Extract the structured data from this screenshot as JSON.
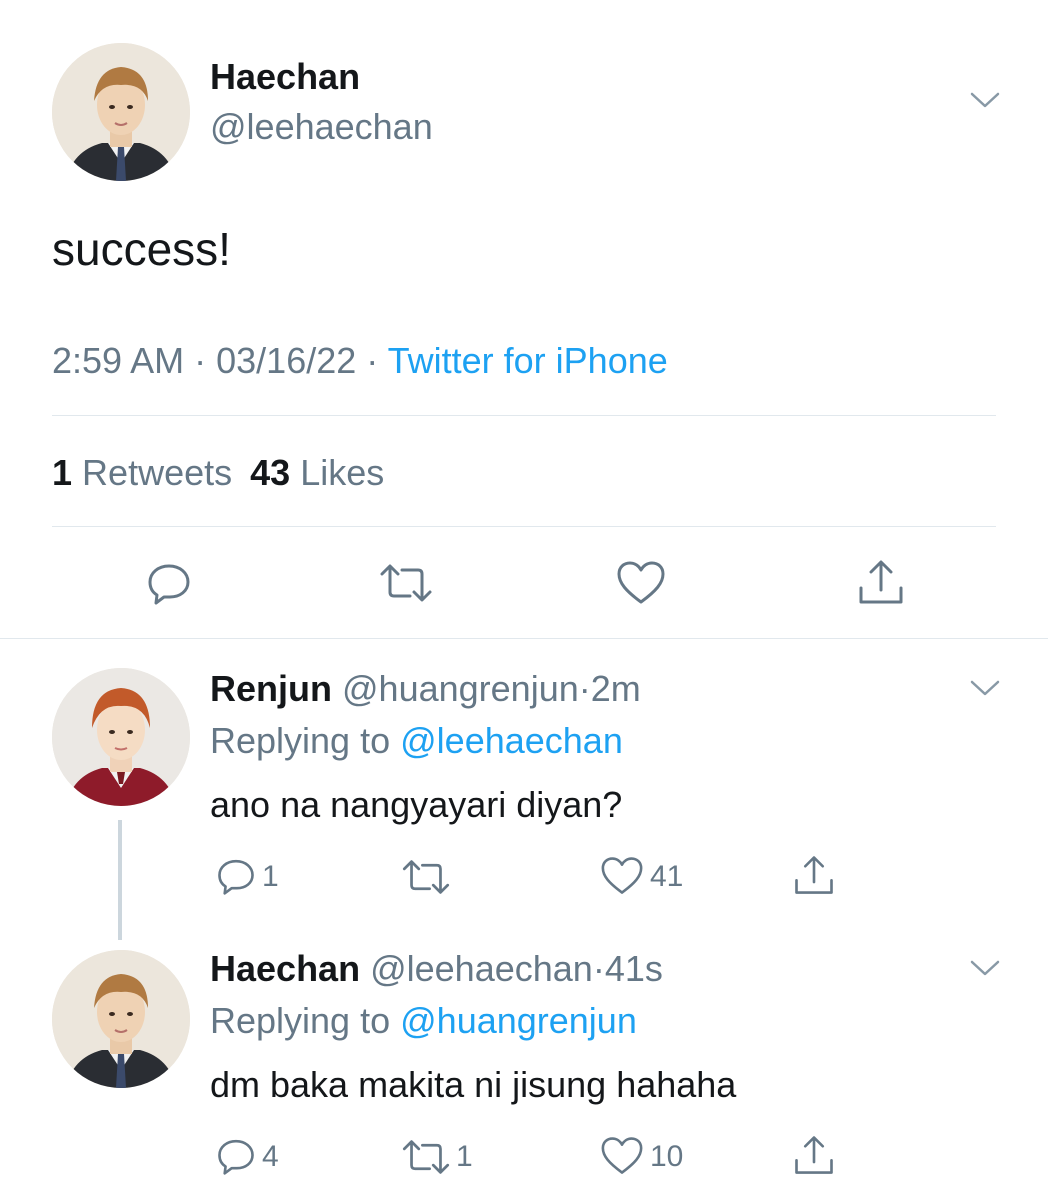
{
  "main_tweet": {
    "display_name": "Haechan",
    "handle": "@leehaechan",
    "text": "success!",
    "time": "2:59 AM",
    "date": "03/16/22",
    "source": "Twitter for iPhone",
    "separator": "·",
    "retweet_count": "1",
    "retweet_label": "Retweets",
    "like_count": "43",
    "like_label": "Likes"
  },
  "replies": [
    {
      "display_name": "Renjun",
      "handle": "@huangrenjun",
      "separator": "·",
      "time": "2m",
      "replying_label": "Replying to",
      "replying_to": "@leehaechan",
      "text": "ano na nangyayari diyan?",
      "reply_count": "1",
      "retweet_count": "",
      "like_count": "41"
    },
    {
      "display_name": "Haechan",
      "handle": "@leehaechan",
      "separator": "·",
      "time": "41s",
      "replying_label": "Replying to",
      "replying_to": "@huangrenjun",
      "text": "dm baka makita ni jisung hahaha",
      "reply_count": "4",
      "retweet_count": "1",
      "like_count": "10"
    }
  ],
  "icons": [
    "chevron-down-icon",
    "reply-icon",
    "retweet-icon",
    "like-icon",
    "share-icon"
  ],
  "colors": {
    "link": "#1da1f2",
    "muted": "#657786",
    "text": "#14171a",
    "divider": "#e1e8ed"
  }
}
